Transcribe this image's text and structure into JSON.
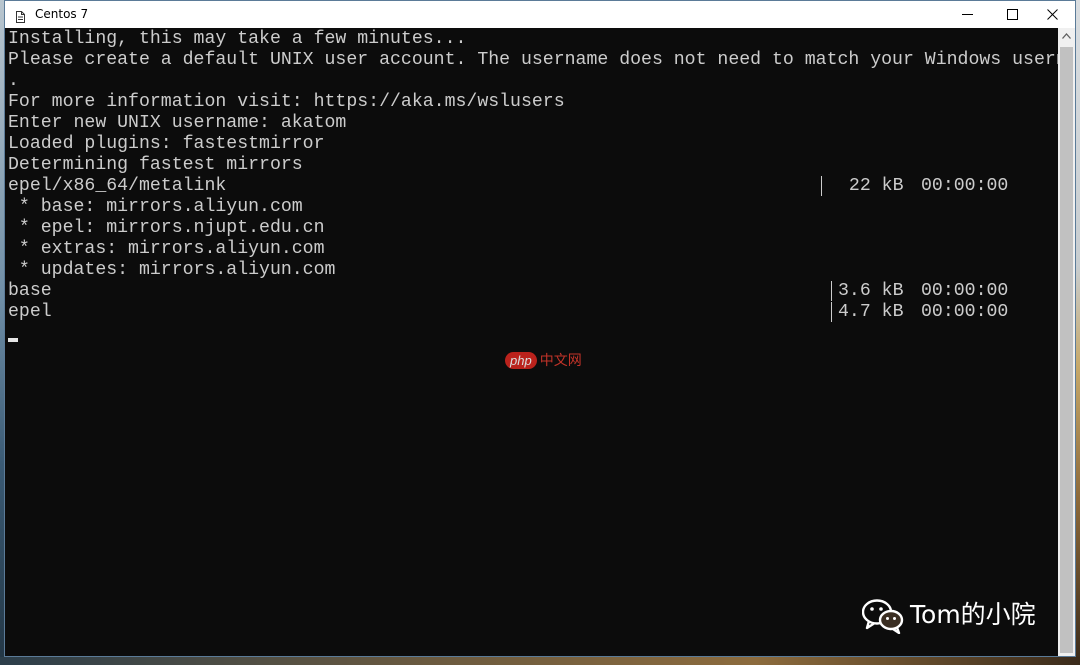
{
  "window": {
    "title": "Centos 7",
    "icon": "document-icon"
  },
  "controls": {
    "minimize": "minimize-icon",
    "maximize": "maximize-icon",
    "close": "close-icon"
  },
  "console": {
    "lines": [
      "Installing, this may take a few minutes...",
      "Please create a default UNIX user account. The username does not need to match your Windows username",
      ".",
      "For more information visit: https://aka.ms/wslusers",
      "Enter new UNIX username: akatom",
      "Loaded plugins: fastestmirror",
      "Determining fastest mirrors",
      "epel/x86_64/metalink",
      " * base: mirrors.aliyun.com",
      " * epel: mirrors.njupt.edu.cn",
      " * extras: mirrors.aliyun.com",
      " * updates: mirrors.aliyun.com",
      "base",
      "epel"
    ],
    "downloads": [
      {
        "size": " 22 kB",
        "time": "00:00:00"
      },
      {
        "size": "3.6 kB",
        "time": "00:00:00"
      },
      {
        "size": "4.7 kB",
        "time": "00:00:00"
      }
    ]
  },
  "watermark": {
    "badge": "php",
    "text": "中文网"
  },
  "brand": {
    "icon": "wechat-icon",
    "text": "Tom的小院"
  },
  "colors": {
    "console_bg": "#0c0c0c",
    "console_fg": "#cccccc",
    "titlebar_bg": "#ffffff"
  }
}
